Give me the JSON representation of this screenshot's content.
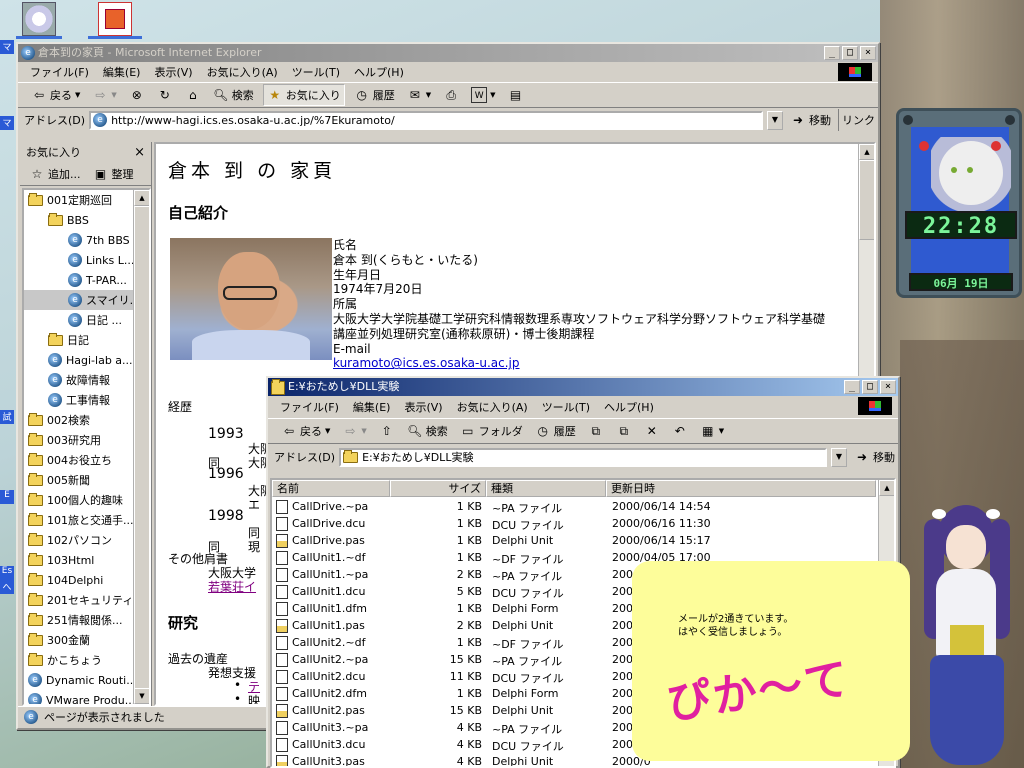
{
  "desktop": {
    "icons": [
      "character-icon",
      "powerpoint-icon"
    ]
  },
  "ie": {
    "title": "倉本到の家頁 - Microsoft Internet Explorer",
    "menu": [
      "ファイル(F)",
      "編集(E)",
      "表示(V)",
      "お気に入り(A)",
      "ツール(T)",
      "ヘルプ(H)"
    ],
    "toolbar": {
      "back": "戻る",
      "search": "検索",
      "favorites": "お気に入り",
      "history": "履歴"
    },
    "address_label": "アドレス(D)",
    "address": "http://www-hagi.ics.es.osaka-u.ac.jp/%7Ekuramoto/",
    "go": "移動",
    "links": "リンク",
    "status": "ページが表示されました"
  },
  "favorites": {
    "title": "お気に入り",
    "add": "追加...",
    "organize": "整理",
    "items": [
      {
        "label": "001定期巡回",
        "type": "folder",
        "indent": 0
      },
      {
        "label": "BBS",
        "type": "folder",
        "indent": 1
      },
      {
        "label": "7th BBS",
        "type": "link",
        "indent": 2
      },
      {
        "label": "Links L...",
        "type": "link",
        "indent": 2
      },
      {
        "label": "T-PAR...",
        "type": "link",
        "indent": 2
      },
      {
        "label": "スマイリ...",
        "type": "link",
        "indent": 2,
        "selected": true
      },
      {
        "label": "日記 ...",
        "type": "link",
        "indent": 2
      },
      {
        "label": "日記",
        "type": "folder",
        "indent": 1
      },
      {
        "label": "Hagi-lab a...",
        "type": "link",
        "indent": 1
      },
      {
        "label": "故障情報",
        "type": "link",
        "indent": 1
      },
      {
        "label": "工事情報",
        "type": "link",
        "indent": 1
      },
      {
        "label": "002検索",
        "type": "folder",
        "indent": 0
      },
      {
        "label": "003研究用",
        "type": "folder",
        "indent": 0
      },
      {
        "label": "004お役立ち",
        "type": "folder",
        "indent": 0
      },
      {
        "label": "005新聞",
        "type": "folder",
        "indent": 0
      },
      {
        "label": "100個人的趣味",
        "type": "folder",
        "indent": 0
      },
      {
        "label": "101旅と交通手...",
        "type": "folder",
        "indent": 0
      },
      {
        "label": "102パソコン",
        "type": "folder",
        "indent": 0
      },
      {
        "label": "103Html",
        "type": "folder",
        "indent": 0
      },
      {
        "label": "104Delphi",
        "type": "folder",
        "indent": 0
      },
      {
        "label": "201セキュリティ",
        "type": "folder",
        "indent": 0
      },
      {
        "label": "251情報閲係...",
        "type": "folder",
        "indent": 0
      },
      {
        "label": "300金蘭",
        "type": "folder",
        "indent": 0
      },
      {
        "label": "かこちょう",
        "type": "folder",
        "indent": 0
      },
      {
        "label": "Dynamic Routi...",
        "type": "link",
        "indent": 0
      },
      {
        "label": "VMware Produ...",
        "type": "link",
        "indent": 0
      }
    ]
  },
  "page": {
    "heading": "倉本 到 の 家頁",
    "intro": "自己紹介",
    "info_lines": [
      "氏名",
      "倉本 到(くらもと・いたる)",
      "生年月日",
      "1974年7月20日",
      "所属",
      "大阪大学大学院基礎工学研究科情報数理系専攻ソフトウェア科学分野ソフトウェア科学基礎",
      "講座並列処理研究室(通称萩原研)・博士後期課程",
      "E-mail"
    ],
    "email": "kuramoto@ics.es.osaka-u.ac.jp",
    "history_label": "経歴",
    "year1": "1993",
    "frag_da1": "大阪",
    "same1": "同",
    "frag_da2": "大阪",
    "year2": "1996",
    "frag_da3": "大阪",
    "frag_e": "エ",
    "year3": "1998",
    "frag_same": "同",
    "same2": "同",
    "frag_gen": "現",
    "other_label": "その他肩書",
    "other_1": "大阪大学",
    "link_young": "若葉荘イ",
    "research": "研究",
    "legacy": "過去の遺産",
    "idea": "発想支援",
    "bullet1_link": "テ",
    "bullet2": "映"
  },
  "explorer": {
    "title": "E:¥おためし¥DLL実験",
    "menu": [
      "ファイル(F)",
      "編集(E)",
      "表示(V)",
      "お気に入り(A)",
      "ツール(T)",
      "ヘルプ(H)"
    ],
    "toolbar": {
      "back": "戻る",
      "search": "検索",
      "folders": "フォルダ",
      "history": "履歴"
    },
    "address_label": "アドレス(D)",
    "address": "E:¥おためし¥DLL実験",
    "go": "移動",
    "columns": {
      "name": "名前",
      "size": "サイズ",
      "type": "種類",
      "date": "更新日時"
    },
    "files": [
      {
        "name": "CallDrive.~pa",
        "size": "1 KB",
        "type": "~PA ファイル",
        "date": "2000/06/14 14:54",
        "icon": "file"
      },
      {
        "name": "CallDrive.dcu",
        "size": "1 KB",
        "type": "DCU ファイル",
        "date": "2000/06/16 11:30",
        "icon": "file"
      },
      {
        "name": "CallDrive.pas",
        "size": "1 KB",
        "type": "Delphi Unit",
        "date": "2000/06/14 15:17",
        "icon": "unit"
      },
      {
        "name": "CallUnit1.~df",
        "size": "1 KB",
        "type": "~DF ファイル",
        "date": "2000/04/05 17:00",
        "icon": "file"
      },
      {
        "name": "CallUnit1.~pa",
        "size": "2 KB",
        "type": "~PA ファイル",
        "date": "2000/0",
        "icon": "file"
      },
      {
        "name": "CallUnit1.dcu",
        "size": "5 KB",
        "type": "DCU ファイル",
        "date": "2000/0",
        "icon": "file"
      },
      {
        "name": "CallUnit1.dfm",
        "size": "1 KB",
        "type": "Delphi Form",
        "date": "2000/0",
        "icon": "form"
      },
      {
        "name": "CallUnit1.pas",
        "size": "2 KB",
        "type": "Delphi Unit",
        "date": "2000/0",
        "icon": "unit"
      },
      {
        "name": "CallUnit2.~df",
        "size": "1 KB",
        "type": "~DF ファイル",
        "date": "2000/0",
        "icon": "file"
      },
      {
        "name": "CallUnit2.~pa",
        "size": "15 KB",
        "type": "~PA ファイル",
        "date": "2000/0",
        "icon": "file"
      },
      {
        "name": "CallUnit2.dcu",
        "size": "11 KB",
        "type": "DCU ファイル",
        "date": "2000/0",
        "icon": "file"
      },
      {
        "name": "CallUnit2.dfm",
        "size": "1 KB",
        "type": "Delphi Form",
        "date": "2000/0",
        "icon": "form"
      },
      {
        "name": "CallUnit2.pas",
        "size": "15 KB",
        "type": "Delphi Unit",
        "date": "2000/0",
        "icon": "unit"
      },
      {
        "name": "CallUnit3.~pa",
        "size": "4 KB",
        "type": "~PA ファイル",
        "date": "2000/0",
        "icon": "file"
      },
      {
        "name": "CallUnit3.dcu",
        "size": "4 KB",
        "type": "DCU ファイル",
        "date": "2000/0",
        "icon": "file"
      },
      {
        "name": "CallUnit3.pas",
        "size": "4 KB",
        "type": "Delphi Unit",
        "date": "2000/0",
        "icon": "unit"
      }
    ]
  },
  "clock": {
    "time": "22:28",
    "date": "06月 19日"
  },
  "note": {
    "line1": "メールが2通きています。",
    "line2": "はやく受信しましょう。",
    "signature": "ぴか〜て"
  },
  "edge_labels": [
    "マ",
    "マ",
    "試",
    "E",
    "Es",
    "へ"
  ]
}
